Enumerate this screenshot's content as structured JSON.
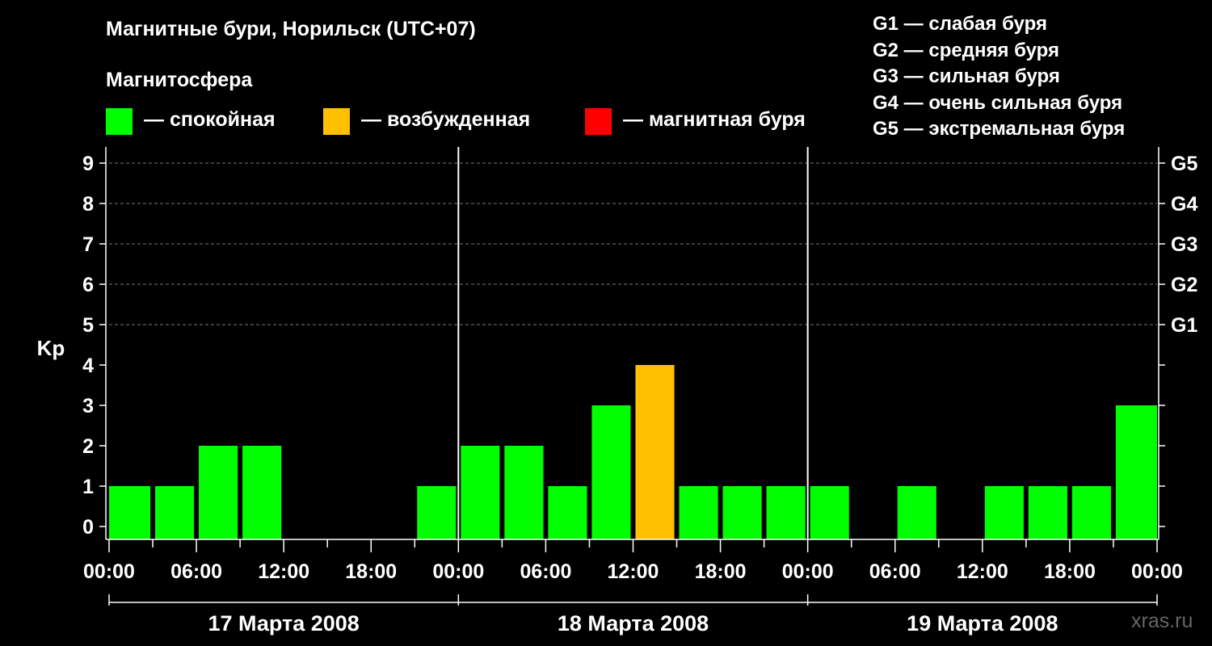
{
  "title": "Магнитные бури, Норильск (UTC+07)",
  "subtitle": "Магнитосфера",
  "legend": [
    {
      "label": "— спокойная",
      "color": "#00ff00"
    },
    {
      "label": "— возбужденная",
      "color": "#ffc000"
    },
    {
      "label": "— магнитная буря",
      "color": "#ff0000"
    }
  ],
  "g_scale": [
    "G1 — слабая буря",
    "G2 — средняя буря",
    "G3 — сильная буря",
    "G4 — очень сильная буря",
    "G5 — экстремальная буря"
  ],
  "watermark": "xras.ru",
  "chart_data": {
    "type": "bar",
    "ylabel": "Kp",
    "ylim": [
      0,
      9
    ],
    "yticks": [
      "0",
      "1",
      "2",
      "3",
      "4",
      "5",
      "6",
      "7",
      "8",
      "9"
    ],
    "right_ticks": [
      {
        "y": 5,
        "label": "G1"
      },
      {
        "y": 6,
        "label": "G2"
      },
      {
        "y": 7,
        "label": "G3"
      },
      {
        "y": 8,
        "label": "G4"
      },
      {
        "y": 9,
        "label": "G5"
      }
    ],
    "xtick_labels": [
      "00:00",
      "06:00",
      "12:00",
      "18:00",
      "00:00",
      "06:00",
      "12:00",
      "18:00",
      "00:00",
      "06:00",
      "12:00",
      "18:00",
      "00:00"
    ],
    "days": [
      "17 Марта 2008",
      "18 Марта 2008",
      "19 Марта 2008"
    ],
    "grid": true,
    "bar_hours": [
      1.5,
      4.5,
      7.5,
      10.5,
      13.5,
      16.5,
      19.5,
      22.5,
      25.5,
      28.5,
      31.5,
      34.5,
      37.5,
      40.5,
      43.5,
      46.5,
      49.5,
      52.5,
      55.5,
      58.5,
      61.5,
      64.5,
      67.5,
      70.5
    ],
    "values": [
      1,
      1,
      2,
      2,
      0,
      0,
      0,
      1,
      2,
      2,
      1,
      3,
      4,
      1,
      1,
      1,
      1,
      0,
      1,
      0,
      1,
      1,
      1,
      3
    ],
    "extra_bars": [
      {
        "hour_start": 0,
        "hour_end": 0.9,
        "value": 1
      },
      {
        "hour_start": 71.1,
        "hour_end": 72,
        "value": 3
      }
    ],
    "colors": {
      "quiet": "#00ff00",
      "active": "#ffc000",
      "storm": "#ff0000"
    }
  }
}
